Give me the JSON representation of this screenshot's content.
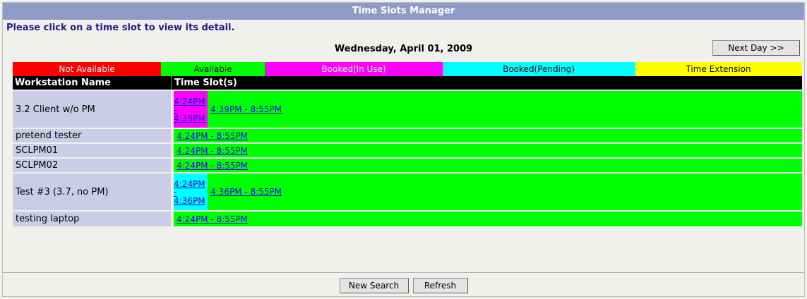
{
  "title": "Time Slots Manager",
  "instruction": "Please click on a time slot to view its detail.",
  "date": "Wednesday, April 01, 2009",
  "next_day_label": "Next Day >>",
  "legend": [
    {
      "label": "Not Available",
      "bg": "#ff0000",
      "fg": "#ffffff"
    },
    {
      "label": "Available",
      "bg": "#00ff00",
      "fg": "#000000"
    },
    {
      "label": "Booked(In Use)",
      "bg": "#ff00ff",
      "fg": "#ffffff"
    },
    {
      "label": "Booked(Pending)",
      "bg": "#00ffff",
      "fg": "#000000"
    },
    {
      "label": "Time Extension",
      "bg": "#ffff00",
      "fg": "#000000"
    }
  ],
  "table": {
    "col_name": "Workstation Name",
    "col_slots": "Time Slot(s)"
  },
  "rows": [
    {
      "name": "3.2 Client w/o PM",
      "pre": {
        "l1": "4:24PM",
        "l2": "-",
        "l3": "4:39PM",
        "status": "booked-in-use"
      },
      "slot": "4:39PM - 8:55PM"
    },
    {
      "name": "pretend tester",
      "slot": "4:24PM - 8:55PM"
    },
    {
      "name": "SCLPM01",
      "slot": "4:24PM - 8:55PM"
    },
    {
      "name": "SCLPM02",
      "slot": "4:24PM - 8:55PM"
    },
    {
      "name": "Test #3 (3.7, no PM)",
      "pre": {
        "l1": "4:24PM",
        "l2": "-",
        "l3": "4:36PM",
        "status": "booked-pending"
      },
      "slot": "4:36PM - 8:55PM"
    },
    {
      "name": "testing laptop",
      "slot": "4:24PM - 8:55PM"
    }
  ],
  "buttons": {
    "new_search": "New Search",
    "refresh": "Refresh"
  }
}
